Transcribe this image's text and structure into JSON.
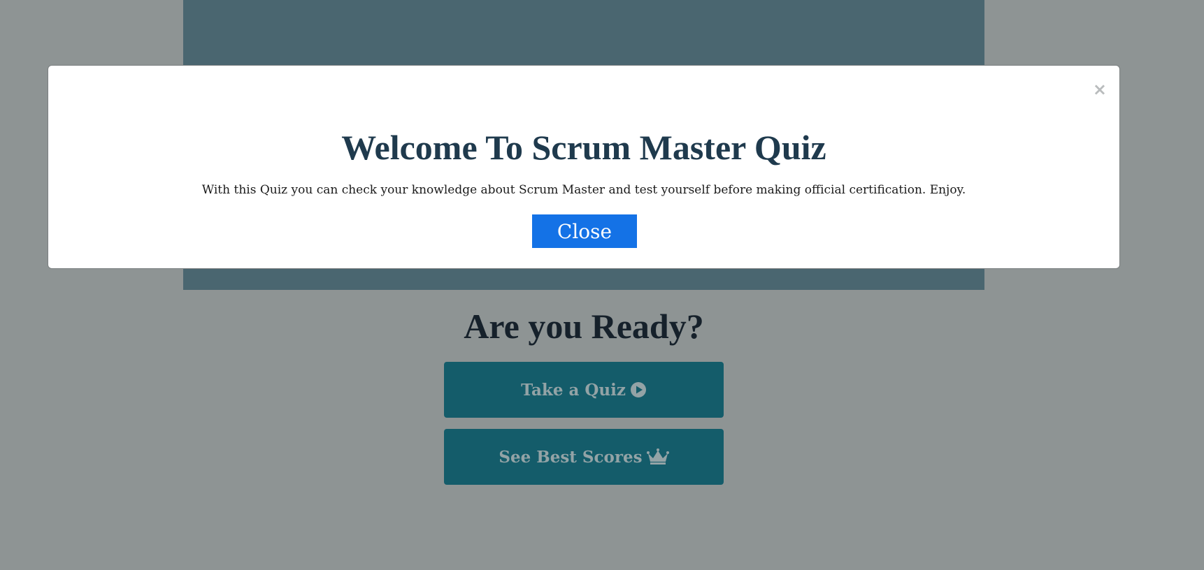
{
  "page": {
    "ready_title": "Are you Ready?",
    "take_quiz_label": "Take a Quiz",
    "best_scores_label": "See Best Scores"
  },
  "modal": {
    "close_x": "×",
    "title": "Welcome To Scrum Master Quiz",
    "text": "With this Quiz you can check your knowledge about Scrum Master and test yourself before making official certification. Enjoy.",
    "close_label": "Close"
  },
  "icons": {
    "play": "play-circle-icon",
    "crown": "crown-icon"
  },
  "colors": {
    "overlay_bg": "#8e9494",
    "button_bg": "#145c6a",
    "close_button": "#1472e6",
    "title": "#1f3a4d"
  }
}
